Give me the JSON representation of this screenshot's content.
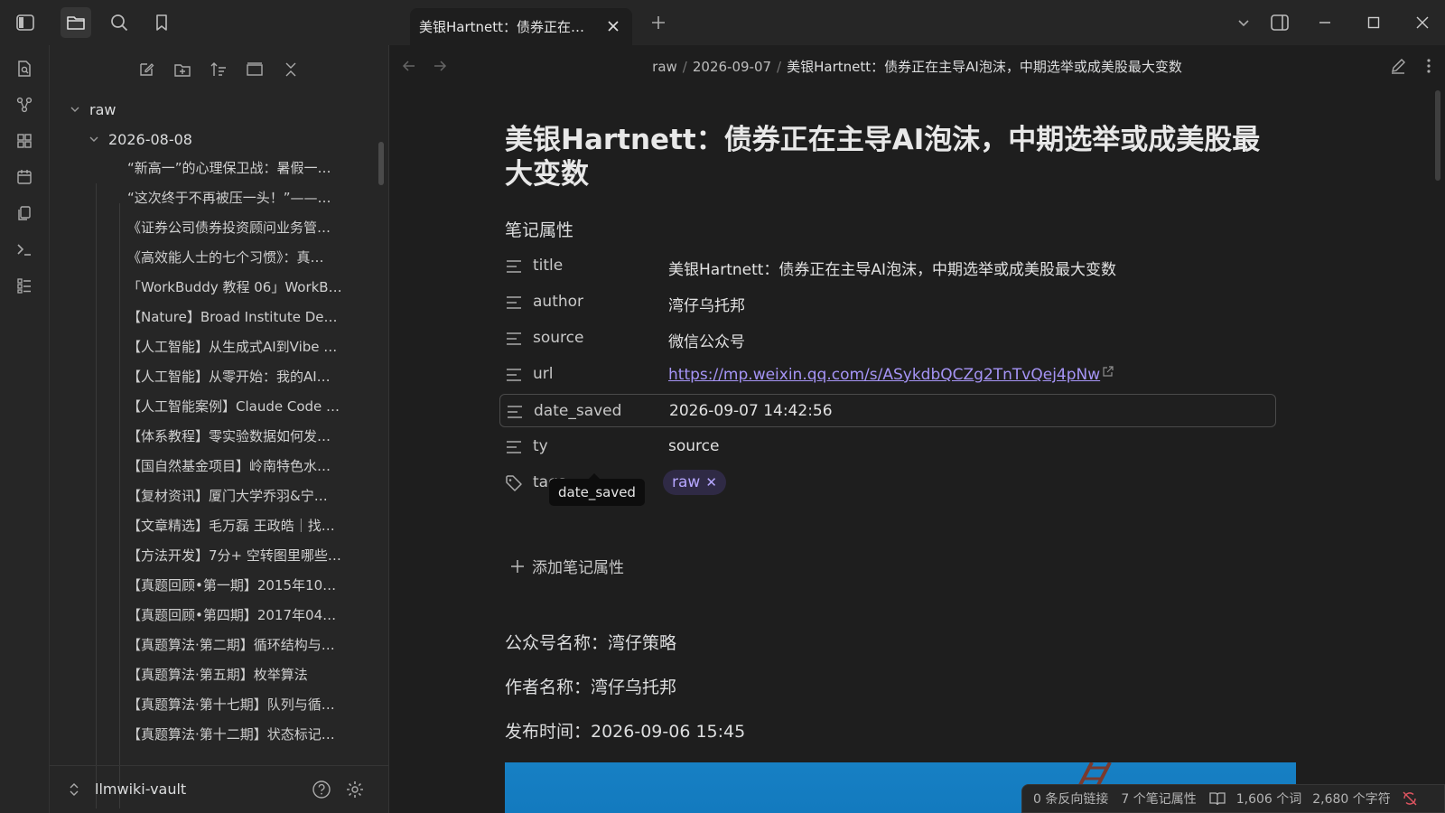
{
  "tab": {
    "title": "美银Hartnett：债券正在…"
  },
  "explorer": {
    "folders": [
      {
        "label": "raw"
      },
      {
        "label": "2026-08-08"
      }
    ],
    "files": [
      "“新高一”的心理保卫战：暑假一…",
      "“这次终于不再被压一头！”——…",
      "《证券公司债券投资顾问业务管…",
      "《高效能人士的七个习惯》：真…",
      "「WorkBuddy 教程 06」WorkB…",
      "【Nature】Broad Institute De…",
      "【人工智能】从生成式AI到Vibe …",
      "【人工智能】从零开始：我的AI…",
      "【人工智能案例】Claude Code …",
      "【体系教程】零实验数据如何发…",
      "【国自然基金项目】岭南特色水…",
      "【复材资讯】厦门大学乔羽&宁…",
      "【文章精选】毛万磊 王政皓｜找…",
      "【方法开发】7分+ 空转图里哪些…",
      "【真题回顾•第一期】2015年10…",
      "【真题回顾•第四期】2017年04…",
      "【真题算法·第二期】循环结构与…",
      "【真题算法·第五期】枚举算法",
      "【真题算法·第十七期】队列与循…",
      "【真题算法·第十二期】状态标记…"
    ],
    "vault_name": "llmwiki-vault"
  },
  "breadcrumb": {
    "parts": [
      "raw",
      "2026-09-07"
    ],
    "current": "美银Hartnett：债券正在主导AI泡沫，中期选举或成美股最大变数"
  },
  "note": {
    "title": "美银Hartnett：债券正在主导AI泡沫，中期选举或成美股最大变数",
    "properties_heading": "笔记属性",
    "properties": {
      "title": {
        "key": "title",
        "value": "美银Hartnett：债券正在主导AI泡沫，中期选举或成美股最大变数"
      },
      "author": {
        "key": "author",
        "value": "湾仔乌托邦"
      },
      "source": {
        "key": "source",
        "value": "微信公众号"
      },
      "url": {
        "key": "url",
        "value": "https://mp.weixin.qq.com/s/ASykdbQCZg2TnTvQej4pNw"
      },
      "date_saved": {
        "key": "date_saved",
        "value": "2026-09-07 14:42:56"
      },
      "type": {
        "key": "ty",
        "value": "source"
      },
      "tags": {
        "key": "tags",
        "value": "raw"
      }
    },
    "tooltip": "date_saved",
    "add_property": "添加笔记属性",
    "body": [
      "公众号名称：湾仔策略",
      "作者名称：湾仔乌托邦",
      "发布时间：2026-09-06 15:45"
    ]
  },
  "statusbar": {
    "backlinks": "0 条反向链接",
    "properties": "7 个笔记属性",
    "words": "1,606 个词",
    "chars": "2,680 个字符"
  },
  "icons": {
    "titlebar": [
      "sidebar-toggle-icon",
      "folder-icon",
      "search-icon",
      "bookmark-icon"
    ],
    "ribbon": [
      "file-search-icon",
      "graph-icon",
      "grid-icon",
      "calendar-icon",
      "copy-icon",
      "terminal-icon",
      "list-icon"
    ],
    "explorer_tools": [
      "new-note-icon",
      "new-folder-icon",
      "sort-icon",
      "collapse-view-icon",
      "collapse-all-icon"
    ]
  },
  "colors": {
    "accent": "#a594f5",
    "tag_bg": "#2f2a45",
    "tag_text": "#b6a7ff",
    "image_blue": "#1780c4"
  }
}
